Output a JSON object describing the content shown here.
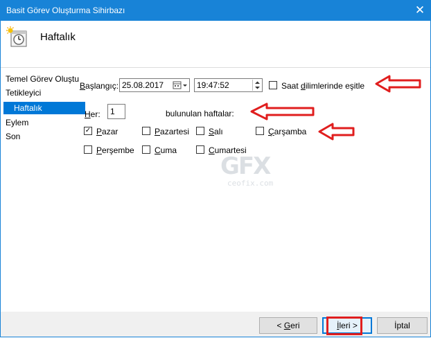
{
  "window": {
    "title": "Basit Görev Oluşturma Sihirbazı",
    "close_glyph": "✕"
  },
  "header": {
    "title": "Haftalık",
    "icon": "clock-calendar-icon"
  },
  "nav": {
    "items": [
      {
        "label": "Temel Görev Oluştu",
        "selected": false
      },
      {
        "label": "Tetikleyici",
        "selected": false
      },
      {
        "label": "Haftalık",
        "selected": true
      },
      {
        "label": "Eylem",
        "selected": false
      },
      {
        "label": "Son",
        "selected": false
      }
    ]
  },
  "form": {
    "start_label_prefix": "B",
    "start_label_rest": "aşlangıç:",
    "date_value": "25.08.2017",
    "time_value": "19:47:52",
    "timezone_prefix": "Saat ",
    "timezone_underlined": "d",
    "timezone_rest": "ilimlerinde eşitle",
    "every_label_prefix": "H",
    "every_label_rest": "er:",
    "every_value": "1",
    "weeks_label": "bulunulan haftalar:",
    "days": [
      {
        "underlined": "P",
        "rest": "azar",
        "checked": true
      },
      {
        "underlined": "P",
        "rest": "azartesi",
        "checked": false
      },
      {
        "underlined": "S",
        "rest": "alı",
        "checked": false
      },
      {
        "underlined": "Ç",
        "rest": "arşamba",
        "checked": false
      },
      {
        "underlined": "P",
        "rest": "erşembe",
        "checked": false
      },
      {
        "underlined": "C",
        "rest": "uma",
        "checked": false
      },
      {
        "underlined": "C",
        "rest": "umartesi",
        "checked": false
      }
    ],
    "check_glyph": "✓"
  },
  "watermark": {
    "logo": "GFX",
    "site": "ceofix.com"
  },
  "footer": {
    "back_prefix": "< ",
    "back_underlined": "G",
    "back_rest": "eri",
    "next_underlined": "İ",
    "next_rest": "leri >",
    "cancel_label": "İptal"
  },
  "colors": {
    "accent": "#0078d7",
    "titlebar": "#1883d7",
    "annotation_red": "#e01e1e"
  }
}
